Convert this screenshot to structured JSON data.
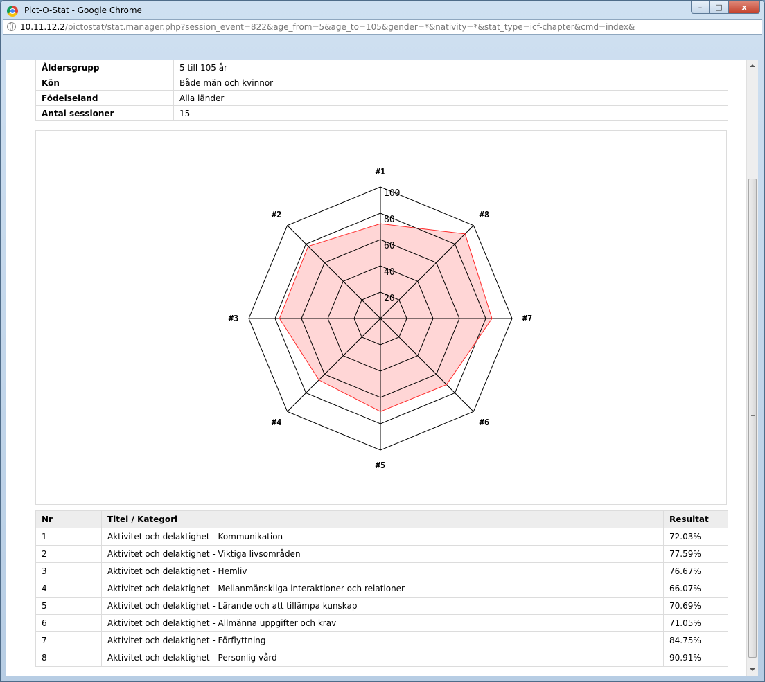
{
  "window": {
    "title": "Pict-O-Stat - Google Chrome",
    "minimize": "–",
    "maximize": "□",
    "close": "x"
  },
  "address": {
    "host": "10.11.12.2",
    "path": "/pictostat/stat.manager.php?session_event=822&age_from=5&age_to=105&gender=*&nativity=*&stat_type=icf-chapter&cmd=index&"
  },
  "info": {
    "rows": [
      {
        "label": "Åldersgrupp",
        "value": "5 till 105 år"
      },
      {
        "label": "Kön",
        "value": "Både män och kvinnor"
      },
      {
        "label": "Födelseland",
        "value": "Alla länder"
      },
      {
        "label": "Antal sessioner",
        "value": "15"
      }
    ]
  },
  "chart_data": {
    "type": "radar",
    "axes": [
      "#1",
      "#2",
      "#3",
      "#4",
      "#5",
      "#6",
      "#7",
      "#8"
    ],
    "values": [
      72.03,
      77.59,
      76.67,
      66.07,
      70.69,
      71.05,
      84.75,
      90.91
    ],
    "ticks": [
      "20",
      "40",
      "60",
      "80",
      "100"
    ],
    "range": [
      0,
      100
    ],
    "fill_color": "#ffd6d6",
    "line_color": "#ff2a2a",
    "grid_color": "#000000"
  },
  "results": {
    "headers": {
      "nr": "Nr",
      "title": "Titel / Kategori",
      "result": "Resultat"
    },
    "rows": [
      {
        "nr": "1",
        "title": "Aktivitet och delaktighet - Kommunikation",
        "result": "72.03%"
      },
      {
        "nr": "2",
        "title": "Aktivitet och delaktighet - Viktiga livsområden",
        "result": "77.59%"
      },
      {
        "nr": "3",
        "title": "Aktivitet och delaktighet - Hemliv",
        "result": "76.67%"
      },
      {
        "nr": "4",
        "title": "Aktivitet och delaktighet - Mellanmänskliga interaktioner och relationer",
        "result": "66.07%"
      },
      {
        "nr": "5",
        "title": "Aktivitet och delaktighet - Lärande och att tillämpa kunskap",
        "result": "70.69%"
      },
      {
        "nr": "6",
        "title": "Aktivitet och delaktighet - Allmänna uppgifter och krav",
        "result": "71.05%"
      },
      {
        "nr": "7",
        "title": "Aktivitet och delaktighet - Förflyttning",
        "result": "84.75%"
      },
      {
        "nr": "8",
        "title": "Aktivitet och delaktighet - Personlig vård",
        "result": "90.91%"
      }
    ]
  }
}
